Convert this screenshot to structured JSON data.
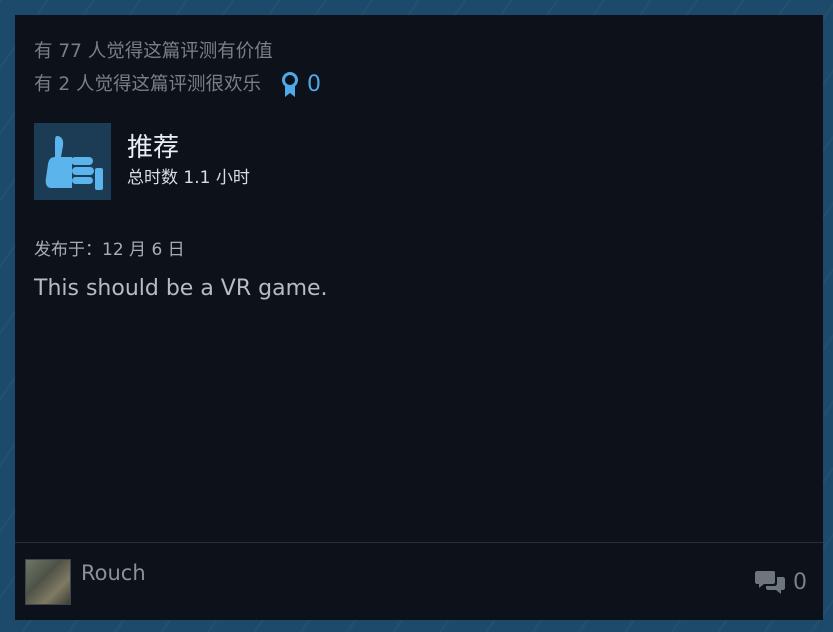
{
  "helpful": {
    "found_helpful": "有 77 人觉得这篇评测有价值",
    "found_funny": "有 2 人觉得这篇评测很欢乐",
    "award_icon": "award-ribbon-icon",
    "award_count": "0"
  },
  "recommendation": {
    "icon": "thumbs-up-icon",
    "title": "推荐",
    "hours": "总时数 1.1 小时"
  },
  "review": {
    "posted": "发布于：12 月 6 日",
    "text": "This should be a VR game."
  },
  "footer": {
    "author": "Rouch",
    "comment_icon": "comment-bubbles-icon",
    "comment_count": "0"
  },
  "colors": {
    "background": "#1d4a6b",
    "card": "#0d1119",
    "accent": "#4fa9e8",
    "thumb": "#5bb4ec"
  }
}
